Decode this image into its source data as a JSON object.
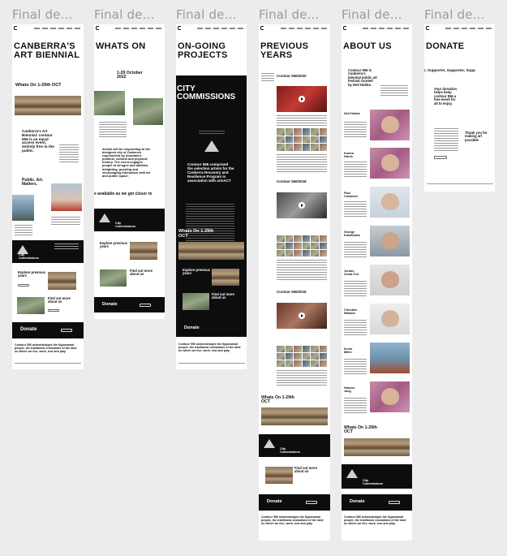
{
  "frames": [
    {
      "title": "Final de..."
    },
    {
      "title": "Final de..."
    },
    {
      "title": "Final de..."
    },
    {
      "title": "Final de..."
    },
    {
      "title": "Final de..."
    },
    {
      "title": "Final de..."
    }
  ],
  "home": {
    "heading": "CANBERRA'S ART BIENNIAL",
    "whats_on": "Whats On 1-29th OCT",
    "intro": "Canberra's Art Biennial: contour 556 is an equal access event, entirely free to the public.",
    "tagline": "Public. Art. Matters.",
    "city_commissions": "City Commissions",
    "explore": "Explore previous years",
    "find_out": "Find out more about us",
    "donate": "Donate",
    "acknowledgement": "Contour 556 acknowledges the Ngunnawal people, the traditional custodians of the land on which we live, work, rest and play."
  },
  "whats_on_page": {
    "heading": "WHATS ON",
    "dates": "1-29 October 2022",
    "body": "Artists will be responding to the designed city of Canberra represented by Australia's political, cultural and physical history. The event engages people of all ages and abilities, delighting, puzzling and encouraging interaction with art and public space.",
    "marquee": "e available as we get closer to",
    "city_commissions": "City Commissions",
    "explore": "Explore previous years",
    "find_out": "Find out more about us",
    "donate": "Donate"
  },
  "projects_page": {
    "heading": "ON-GOING PROJECTS",
    "city_commissions": "CITY COMMISSIONS",
    "body": "Contour 556 comprised the selection artists for the Canberra Recovery and Resilience Program in association with artsACT",
    "whats_on": "Whats On 1-29th OCT",
    "explore": "Explore previous years",
    "find_out": "Find out more about us",
    "donate": "Donate",
    "acknowledgement": "Contour 556 acknowledges the Ngunnawal people, the traditional custodians of the land on which we live, work, rest and play."
  },
  "previous_page": {
    "heading": "PREVIOUS YEARS",
    "y2020": "Contour 556/2020",
    "y2018": "Contour 556/2018",
    "y2016": "Contour 556/2016",
    "whats_on": "Whats On 1-29th OCT",
    "city_commissions": "City Commissions",
    "find_out": "Find out more about us",
    "donate": "Donate",
    "acknowledgement": "Contour 556 acknowledges the Ngunnawal people, the traditional custodians of the land on which we live, work, rest and play."
  },
  "about_page": {
    "heading": "ABOUT US",
    "intro": "Contour 556 is Canberra's biennial public art festival curated by Neil Hobbs.",
    "people": [
      "Neil Hobbs",
      "Karina Harris",
      "Paul Crawford",
      "George Katsiklakis",
      "Jordan Zonia-Toll",
      "Christine Wallace",
      "Kevin Miller",
      "Hoazen Jang"
    ],
    "whats_on": "Whats On 1-29th OCT",
    "city_commissions": "City Commissions",
    "donate": "Donate",
    "acknowledgement": "Contour 556 acknowledges the Ngunnawal people, the traditional custodians of the land on which we live, work, rest and play."
  },
  "donate_page": {
    "heading": "DONATE",
    "marquee": "r, Supporter, Supporter, Supp",
    "pitch": "Your donation helps keep contour 556 a free event for all to enjoy.",
    "thanks": "Thank you for making art possible"
  }
}
